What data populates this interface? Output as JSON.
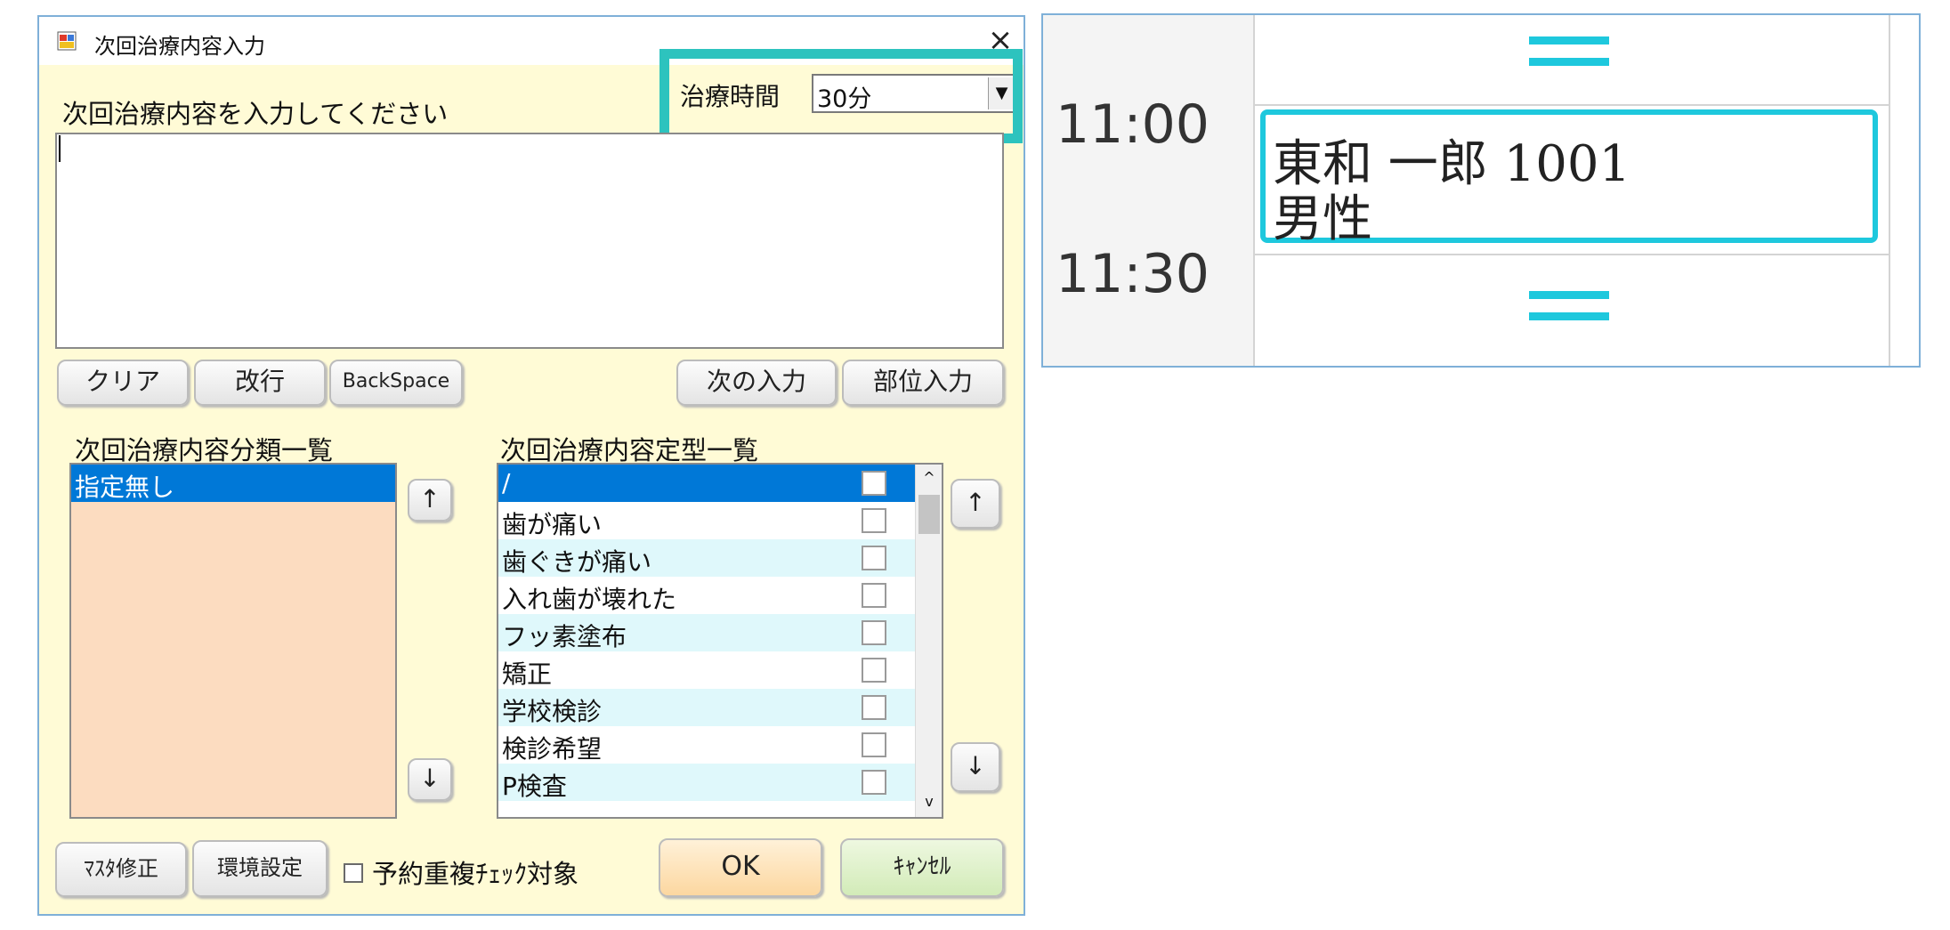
{
  "dialog": {
    "title": "次回治療内容入力",
    "close_glyph": "×",
    "instruction": "次回治療内容を入力してください",
    "treatment_time": {
      "label": "治療時間",
      "value": "30分",
      "arrow": "▼"
    },
    "textarea_value": "",
    "buttons": {
      "clear": "クリア",
      "newline": "改行",
      "backspace": "BackSpace",
      "next_input": "次の入力",
      "part_input": "部位入力",
      "master_edit": "ﾏｽﾀ修正",
      "settings": "環境設定",
      "ok": "OK",
      "cancel": "ｷｬﾝｾﾙ",
      "up": "↑",
      "down": "↓"
    },
    "category_list": {
      "title": "次回治療内容分類一覧",
      "items": [
        "指定無し"
      ]
    },
    "template_list": {
      "title": "次回治療内容定型一覧",
      "items": [
        "/",
        "歯が痛い",
        "歯ぐきが痛い",
        "入れ歯が壊れた",
        "フッ素塗布",
        "矯正",
        "学校検診",
        "検診希望",
        "P検査"
      ],
      "scroll_up": "^",
      "scroll_down": "v"
    },
    "duplicate_check_label": "予約重複ﾁｪｯｸ対象"
  },
  "schedule": {
    "times": [
      "11:00",
      "11:30"
    ],
    "appointment": {
      "line1": "東和 一郎  1001",
      "line2": "男性"
    }
  },
  "colors": {
    "dialog_bg": "#fffbd6",
    "highlight": "#2dc3be",
    "selected": "#0078d7",
    "category_bg": "#fcdcc0",
    "alt_row": "#dff8fb",
    "ok_button": "#fde0b4",
    "cancel_button": "#dff0c8",
    "appointment_border": "#1ec8dd"
  }
}
